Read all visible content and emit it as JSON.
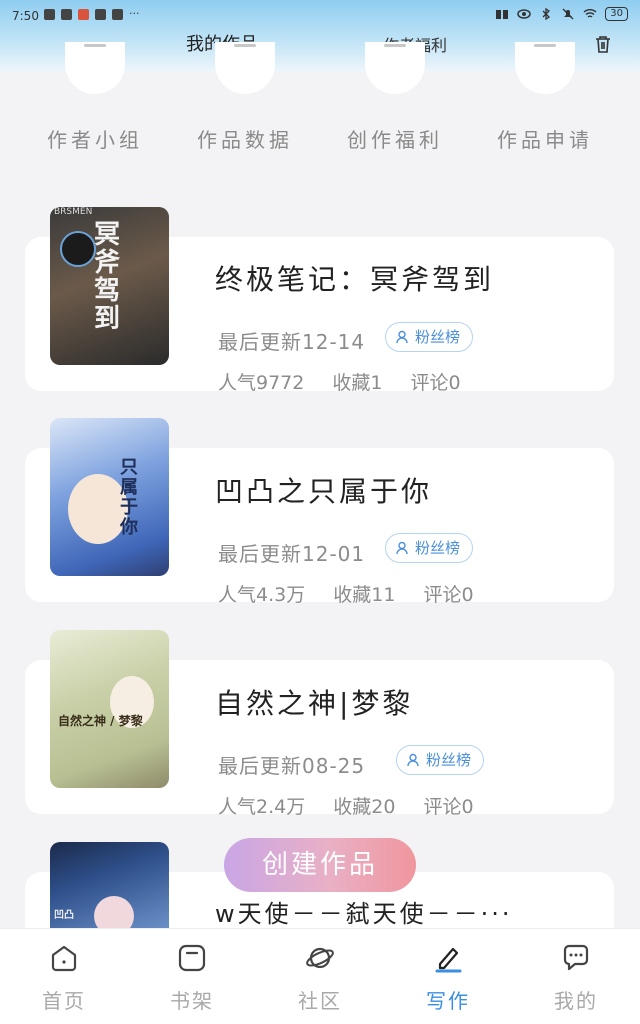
{
  "status": {
    "time": "7:50",
    "battery": "30",
    "more": "···"
  },
  "header": {
    "tab_my_works": "我的作品",
    "tab_author_welfare": "作者福利"
  },
  "quick_actions": [
    {
      "label": "作者小组"
    },
    {
      "label": "作品数据"
    },
    {
      "label": "创作福利"
    },
    {
      "label": "作品申请"
    }
  ],
  "works": [
    {
      "title": "终极笔记：冥斧驾到",
      "last_update": "最后更新12-14",
      "fan_label": "粉丝榜",
      "popularity": "人气9772",
      "favorites": "收藏1",
      "comments": "评论0",
      "cover_text": "冥斧驾到",
      "cover_tag": "BRSMEN"
    },
    {
      "title": "凹凸之只属于你",
      "last_update": "最后更新12-01",
      "fan_label": "粉丝榜",
      "popularity": "人气4.3万",
      "favorites": "收藏11",
      "comments": "评论0",
      "cover_text": "只属于你"
    },
    {
      "title": "自然之神|梦黎",
      "last_update": "最后更新08-25",
      "fan_label": "粉丝榜",
      "popularity": "人气2.4万",
      "favorites": "收藏20",
      "comments": "评论0",
      "cover_text": "自然之神 / 梦黎"
    },
    {
      "title": "w天使－－弑天使－－···",
      "cover_text": "凹凸"
    }
  ],
  "create_button": "创建作品",
  "bottom_nav": [
    {
      "label": "首页",
      "icon": "home-icon",
      "active": false
    },
    {
      "label": "书架",
      "icon": "bookshelf-icon",
      "active": false
    },
    {
      "label": "社区",
      "icon": "planet-icon",
      "active": false
    },
    {
      "label": "写作",
      "icon": "pen-icon",
      "active": true
    },
    {
      "label": "我的",
      "icon": "chat-icon",
      "active": false
    }
  ],
  "colors": {
    "accent": "#3a8fe3",
    "badge_text": "#4a8fdc",
    "header_top": "#8fcdf0"
  }
}
